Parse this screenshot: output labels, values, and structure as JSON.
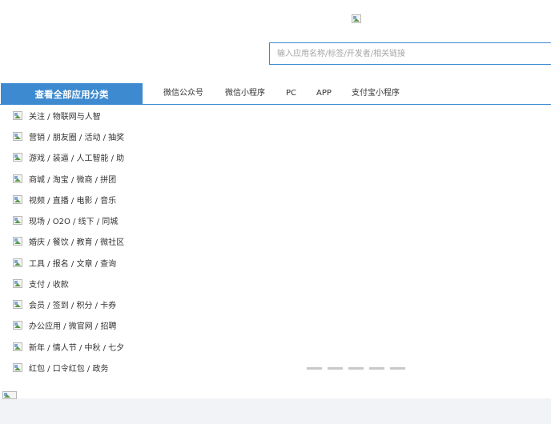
{
  "search": {
    "placeholder": "输入应用名称/标签/开发者/相关链接",
    "value": ""
  },
  "nav": {
    "all_categories": "查看全部应用分类",
    "tabs": [
      {
        "label": "微信公众号"
      },
      {
        "label": "微信小程序"
      },
      {
        "label": "PC"
      },
      {
        "label": "APP"
      },
      {
        "label": "支付宝小程序"
      }
    ]
  },
  "categories": [
    {
      "label": "关注 / 物联网与人智"
    },
    {
      "label": "营销 / 朋友圈 / 活动 / 抽奖"
    },
    {
      "label": "游戏 / 装逼 / 人工智能 / 助"
    },
    {
      "label": "商城 / 淘宝 / 微商 / 拼团"
    },
    {
      "label": "视频 / 直播 / 电影 / 音乐"
    },
    {
      "label": "现场 / O2O / 线下 / 同城"
    },
    {
      "label": "婚庆 / 餐饮 / 教育 / 微社区"
    },
    {
      "label": "工具 / 报名 / 文章 / 查询"
    },
    {
      "label": "支付 / 收款"
    },
    {
      "label": "会员 / 签到 / 积分 / 卡券"
    },
    {
      "label": "办公应用 / 微官网 / 招聘"
    },
    {
      "label": "新年 / 情人节 / 中秋 / 七夕"
    },
    {
      "label": "红包 / 口令红包 / 政务"
    }
  ],
  "carousel": {
    "slides": 5
  },
  "colors": {
    "accent": "#3d8ad0",
    "footer_bg": "#f2f3f6",
    "indicator": "#c8c8c8"
  },
  "icons": {
    "logo": "broken-image-icon",
    "category": "broken-image-icon",
    "footer": "broken-image-icon"
  }
}
